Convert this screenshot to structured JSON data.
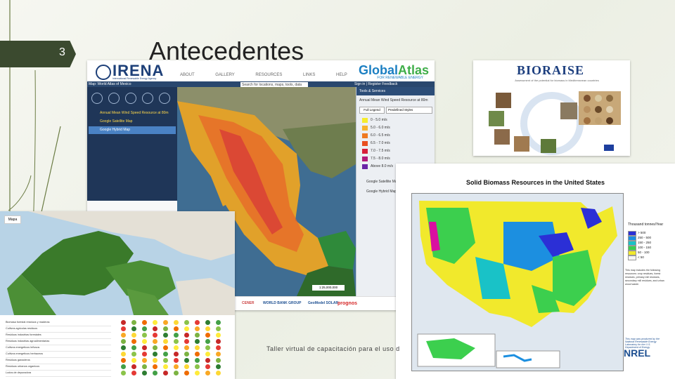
{
  "slide": {
    "number": "3",
    "title": "Antecedentes",
    "footer": "Taller virtual de capacitación para el uso d"
  },
  "irena": {
    "logo": "IRENA",
    "logo_sub": "International Renewable Energy Agency",
    "atlas_logo_a": "Global",
    "atlas_logo_b": "Atlas",
    "atlas_sub": "FOR RENEWABLE ENERGY",
    "menu": "ABOUT GALLERY RESOURCES LINKS HELP",
    "search_placeholder": "Search for locations, maps, tools, data",
    "signin": "Sign in | Register   Feedback",
    "panel_title": "Map: World Atlas of Mexico",
    "layers": [
      "Annual Mean Wind Speed Resource at 80m",
      "Google Satellite Map",
      "Google Hybrid Map"
    ],
    "right_head": "Tools & Services",
    "right_layer": "Annual Mean Wind Speed Resource at 80m",
    "legend_btn": "Full Legend",
    "legend_select": "Predefined Styles",
    "legend": [
      {
        "label": "0 - 5.0 m/s",
        "color": "#f6ec2d"
      },
      {
        "label": "5.0 - 6.0 m/s",
        "color": "#f7b32c"
      },
      {
        "label": "6.0 - 6.5 m/s",
        "color": "#ef7a22"
      },
      {
        "label": "6.5 - 7.0 m/s",
        "color": "#e94f1f"
      },
      {
        "label": "7.0 - 7.5 m/s",
        "color": "#d71f3a"
      },
      {
        "label": "7.5 - 8.0 m/s",
        "color": "#b21a7b"
      },
      {
        "label": "Above 8.0 m/s",
        "color": "#6a24a6"
      }
    ],
    "right_layers": [
      "Google Satellite Map",
      "Google Hybrid Map"
    ],
    "scale": "1:25,000,000",
    "partners": [
      "CENER",
      "WORLD BANK GROUP",
      "GeoModel SOLAR",
      "prognos"
    ]
  },
  "bioraise": {
    "title": "BIORAISE",
    "subtitle": "Assessment of the potential for biomass in Mediterranean countries"
  },
  "usmap": {
    "title": "Solid Biomass Resources in the United States",
    "legend_title": "Thousand tonnes/Year",
    "legend": [
      {
        "label": "> 500",
        "color": "#2b2fd6"
      },
      {
        "label": "250 - 500",
        "color": "#1c8fe0"
      },
      {
        "label": "150 - 250",
        "color": "#19c2c7"
      },
      {
        "label": "100 - 150",
        "color": "#3ccf4e"
      },
      {
        "label": "50 - 100",
        "color": "#f1e92c"
      },
      {
        "label": "< 50",
        "color": "#f5f5f5"
      }
    ],
    "note": "This map includes the following resources: crop residues, forest residues, primary mill residues, secondary mill residues, and urban wood waste.",
    "credit": "This map was produced by the National Renewable Energy Laboratory for the U.S. Department of Energy",
    "nrel": "NREL"
  },
  "europe": {
    "control": "Mapa",
    "rows": [
      "Biomasa forestal residuos y maderas",
      "Cultivos agricolas residuos",
      "Residuos industrias forestales",
      "Residuos industrias agroalimentarias",
      "Cultivos energeticos leñosos",
      "Cultivos energeticos herbaceos",
      "Residuos ganaderos",
      "Residuos urbanos organicos",
      "Lodos de depuradora"
    ],
    "dot_colors": [
      "#c62828",
      "#e53935",
      "#f9a825",
      "#7cb342",
      "#2e7d32",
      "#fdd835",
      "#ef6c00",
      "#43a047",
      "#8bc34a",
      "#ffeb3b"
    ]
  }
}
